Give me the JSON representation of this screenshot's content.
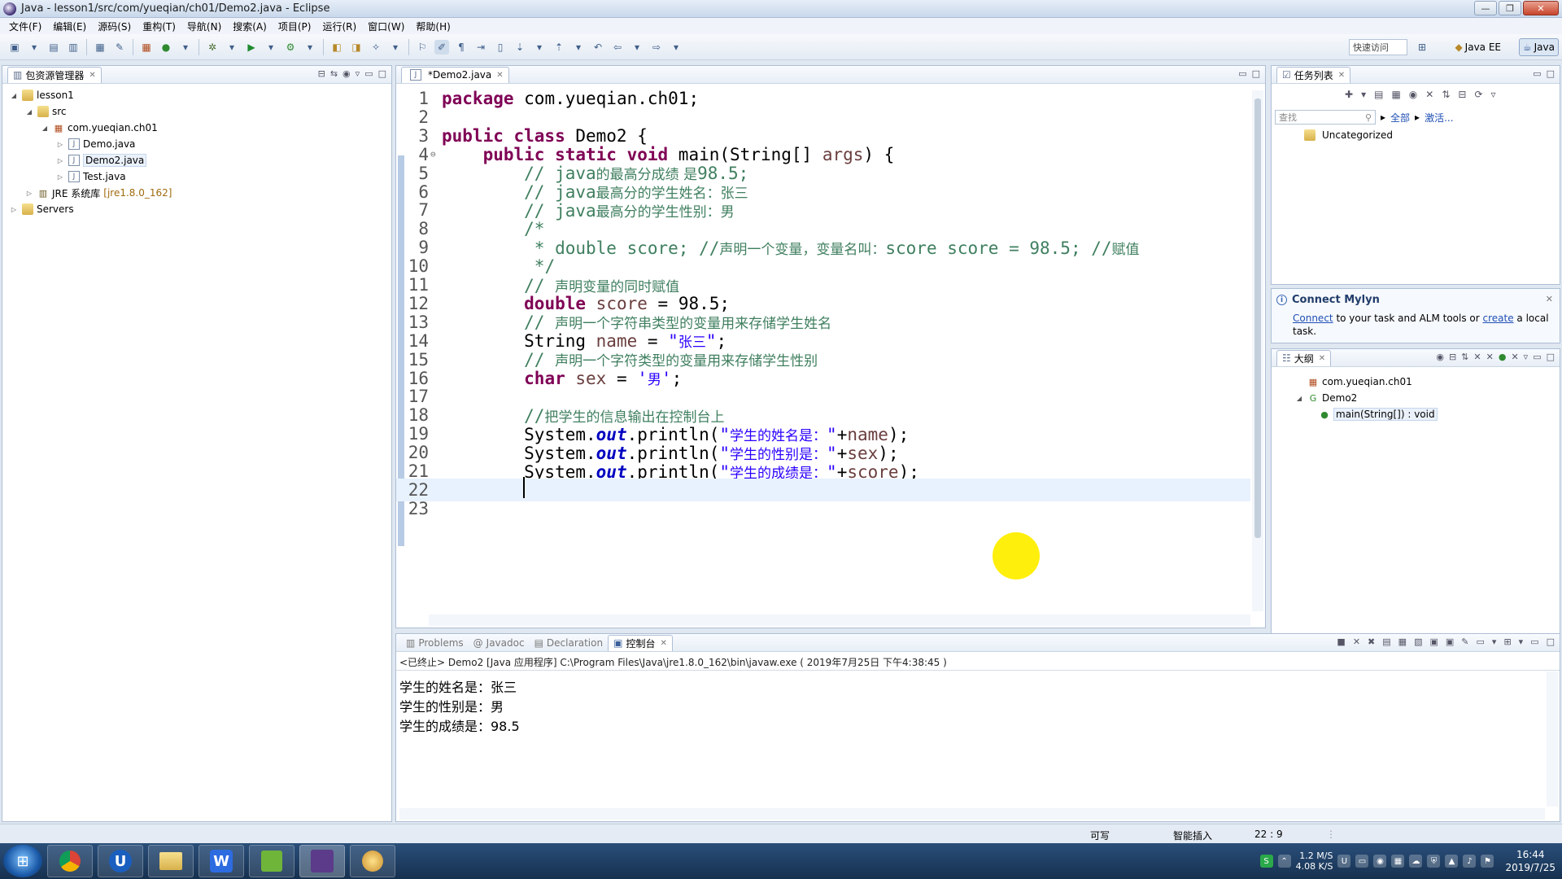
{
  "window": {
    "title": "Java - lesson1/src/com/yueqian/ch01/Demo2.java - Eclipse",
    "buttons": {
      "minimize": "—",
      "restore": "❐",
      "close": "✕"
    }
  },
  "menu": [
    "文件(F)",
    "编辑(E)",
    "源码(S)",
    "重构(T)",
    "导航(N)",
    "搜索(A)",
    "项目(P)",
    "运行(R)",
    "窗口(W)",
    "帮助(H)"
  ],
  "toolbar": {
    "quick_access": "快速访问",
    "perspectives": [
      "Java EE",
      "Java"
    ]
  },
  "package_explorer": {
    "tab": "包资源管理器",
    "tree": [
      {
        "label": "lesson1",
        "depth": 0,
        "twisty": "open",
        "icon": "project-folder-icon"
      },
      {
        "label": "src",
        "depth": 1,
        "twisty": "open",
        "icon": "source-folder-icon"
      },
      {
        "label": "com.yueqian.ch01",
        "depth": 2,
        "twisty": "open",
        "icon": "package-icon"
      },
      {
        "label": "Demo.java",
        "depth": 3,
        "twisty": "closed",
        "icon": "java-file-icon"
      },
      {
        "label": "Demo2.java",
        "depth": 3,
        "twisty": "closed",
        "icon": "java-file-icon",
        "selected": true
      },
      {
        "label": "Test.java",
        "depth": 3,
        "twisty": "closed",
        "icon": "java-file-icon"
      },
      {
        "label": "JRE 系统库",
        "suffix": "[jre1.8.0_162]",
        "depth": 1,
        "twisty": "closed",
        "icon": "library-icon"
      },
      {
        "label": "Servers",
        "depth": 0,
        "twisty": "closed",
        "icon": "project-folder-icon"
      }
    ]
  },
  "editor": {
    "tab": "*Demo2.java",
    "current_line": 22,
    "lines": [
      [
        [
          "kw",
          "package"
        ],
        [
          "p",
          " com.yueqian.ch01;"
        ]
      ],
      [],
      [
        [
          "kw",
          "public class"
        ],
        [
          "p",
          " Demo2 {"
        ]
      ],
      [
        [
          "p",
          "    "
        ],
        [
          "kw",
          "public static void"
        ],
        [
          "p",
          " main(String[] "
        ],
        [
          "var",
          "args"
        ],
        [
          "p",
          ") {"
        ]
      ],
      [
        [
          "p",
          "        "
        ],
        [
          "cm",
          "// java"
        ],
        [
          "cmc",
          "的最高分成绩 是"
        ],
        [
          "cm",
          "98.5;"
        ]
      ],
      [
        [
          "p",
          "        "
        ],
        [
          "cm",
          "// java"
        ],
        [
          "cmc",
          "最高分的学生姓名：张三"
        ]
      ],
      [
        [
          "p",
          "        "
        ],
        [
          "cm",
          "// java"
        ],
        [
          "cmc",
          "最高分的学生性别：男"
        ]
      ],
      [
        [
          "p",
          "        "
        ],
        [
          "cm",
          "/*"
        ]
      ],
      [
        [
          "p",
          "         "
        ],
        [
          "cm",
          "* double score; //"
        ],
        [
          "cmc",
          "声明一个变量，变量名叫："
        ],
        [
          "cm",
          "score score = 98.5; //"
        ],
        [
          "cmc",
          "赋值"
        ]
      ],
      [
        [
          "p",
          "         "
        ],
        [
          "cm",
          "*/"
        ]
      ],
      [
        [
          "p",
          "        "
        ],
        [
          "cm",
          "// "
        ],
        [
          "cmc",
          "声明变量的同时赋值"
        ]
      ],
      [
        [
          "p",
          "        "
        ],
        [
          "kw",
          "double"
        ],
        [
          "p",
          " "
        ],
        [
          "var",
          "score"
        ],
        [
          "p",
          " = 98.5;"
        ]
      ],
      [
        [
          "p",
          "        "
        ],
        [
          "cm",
          "// "
        ],
        [
          "cmc",
          "声明一个字符串类型的变量用来存储学生姓名"
        ]
      ],
      [
        [
          "p",
          "        String "
        ],
        [
          "var",
          "name"
        ],
        [
          "p",
          " = "
        ],
        [
          "str",
          "\""
        ],
        [
          "strc",
          "张三"
        ],
        [
          "str",
          "\""
        ],
        [
          "p",
          ";"
        ]
      ],
      [
        [
          "p",
          "        "
        ],
        [
          "cm",
          "// "
        ],
        [
          "cmc",
          "声明一个字符类型的变量用来存储学生性别"
        ]
      ],
      [
        [
          "p",
          "        "
        ],
        [
          "kw",
          "char"
        ],
        [
          "p",
          " "
        ],
        [
          "var",
          "sex"
        ],
        [
          "p",
          " = "
        ],
        [
          "str",
          "'"
        ],
        [
          "strc",
          "男"
        ],
        [
          "str",
          "'"
        ],
        [
          "p",
          ";"
        ]
      ],
      [],
      [
        [
          "p",
          "        "
        ],
        [
          "cm",
          "//"
        ],
        [
          "cmc",
          "把学生的信息输出在控制台上"
        ]
      ],
      [
        [
          "p",
          "        System."
        ],
        [
          "fld",
          "out"
        ],
        [
          "p",
          ".println("
        ],
        [
          "str",
          "\""
        ],
        [
          "strc",
          "学生的姓名是："
        ],
        [
          "str",
          "\""
        ],
        [
          "p",
          "+"
        ],
        [
          "var",
          "name"
        ],
        [
          "p",
          ");"
        ]
      ],
      [
        [
          "p",
          "        System."
        ],
        [
          "fld",
          "out"
        ],
        [
          "p",
          ".println("
        ],
        [
          "str",
          "\""
        ],
        [
          "strc",
          "学生的性别是："
        ],
        [
          "str",
          "\""
        ],
        [
          "p",
          "+"
        ],
        [
          "var",
          "sex"
        ],
        [
          "p",
          ");"
        ]
      ],
      [
        [
          "p",
          "        System."
        ],
        [
          "fld",
          "out"
        ],
        [
          "p",
          ".println("
        ],
        [
          "str",
          "\""
        ],
        [
          "strc",
          "学生的成绩是："
        ],
        [
          "str",
          "\""
        ],
        [
          "p",
          "+"
        ],
        [
          "var",
          "score"
        ],
        [
          "p",
          ");"
        ]
      ],
      [],
      []
    ]
  },
  "task_list": {
    "tab": "任务列表",
    "search_placeholder": "查找",
    "filter_all": "全部",
    "filter_activate": "激活...",
    "category": "Uncategorized"
  },
  "mylyn": {
    "title": "Connect Mylyn",
    "connect": "Connect",
    "middle": " to your task and ALM tools or ",
    "create": "create",
    "tail": " a local task."
  },
  "outline": {
    "tab": "大纲",
    "items": [
      {
        "label": "com.yueqian.ch01",
        "icon": "package-declaration-icon"
      },
      {
        "label": "Demo2",
        "icon": "class-icon"
      },
      {
        "label": "main(String[]) : void",
        "icon": "method-icon"
      }
    ]
  },
  "console": {
    "tabs": [
      "Problems",
      "Javadoc",
      "Declaration",
      "控制台"
    ],
    "active_tab": "控制台",
    "terminated": "<已终止> Demo2 [Java 应用程序] C:\\Program Files\\Java\\jre1.8.0_162\\bin\\javaw.exe ( 2019年7月25日 下午4:38:45 )",
    "output": [
      "学生的姓名是：张三",
      "学生的性别是：男",
      "学生的成绩是：98.5"
    ]
  },
  "status": {
    "writable": "可写",
    "insert_mode": "智能插入",
    "position": "22 : 9"
  },
  "taskbar": {
    "speed_up": "1.2 M/S",
    "speed_down": "4.08 K/S",
    "time": "16:44",
    "date": "2019/7/25"
  }
}
